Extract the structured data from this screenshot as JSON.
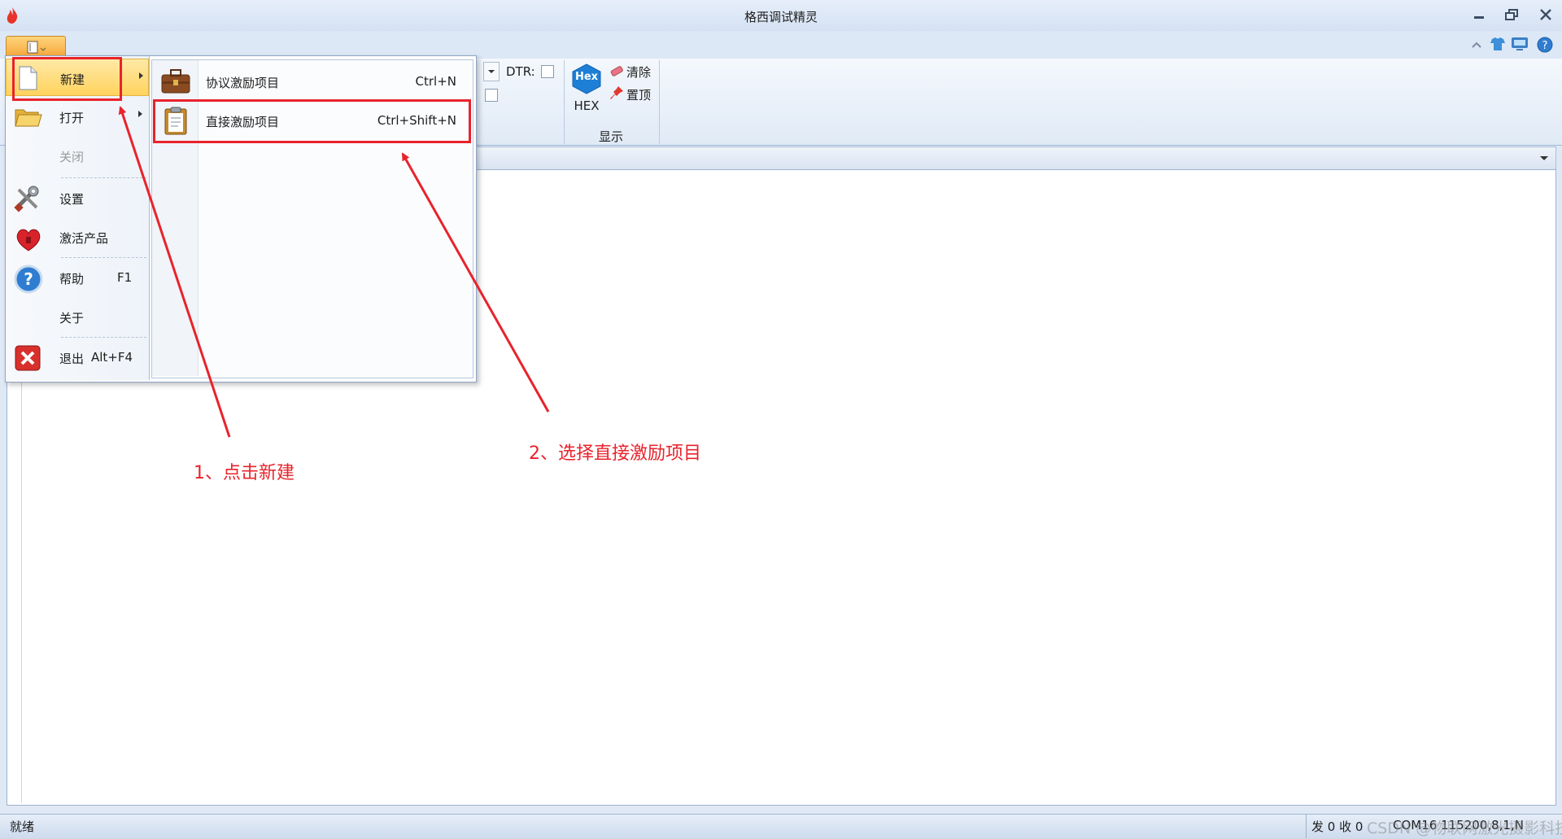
{
  "window": {
    "title": "格西调试精灵"
  },
  "ribbon": {
    "dtr_label": "DTR:",
    "hex_badge": "Hex",
    "hex_label": "HEX",
    "clear_label": "清除",
    "pin_top_label": "置顶",
    "display_group": "显示"
  },
  "menu": {
    "items": [
      {
        "label": "新建",
        "has_submenu": true,
        "icon": "new-document-icon"
      },
      {
        "label": "打开",
        "has_submenu": true,
        "icon": "folder-open-icon"
      },
      {
        "label": "关闭",
        "disabled": true
      },
      {
        "label": "设置",
        "icon": "tools-icon"
      },
      {
        "label": "激活产品",
        "icon": "heart-lock-icon"
      },
      {
        "label": "帮助",
        "shortcut": "F1",
        "icon": "help-icon"
      },
      {
        "label": "关于"
      },
      {
        "label": "退出",
        "shortcut": "Alt+F4",
        "icon": "exit-icon"
      }
    ]
  },
  "submenu": {
    "items": [
      {
        "label": "协议激励项目",
        "shortcut": "Ctrl+N",
        "icon": "briefcase-icon"
      },
      {
        "label": "直接激励项目",
        "shortcut": "Ctrl+Shift+N",
        "icon": "clipboard-icon"
      }
    ]
  },
  "annotations": {
    "step1": "1、点击新建",
    "step2": "2、选择直接激励项目",
    "color": "#e8232c"
  },
  "statusbar": {
    "ready": "就绪",
    "counts": "发 0 收 0",
    "port_info": "COM16 115200,8,1,N"
  },
  "watermark": "CSDN @物联网激光摄影科技学长"
}
